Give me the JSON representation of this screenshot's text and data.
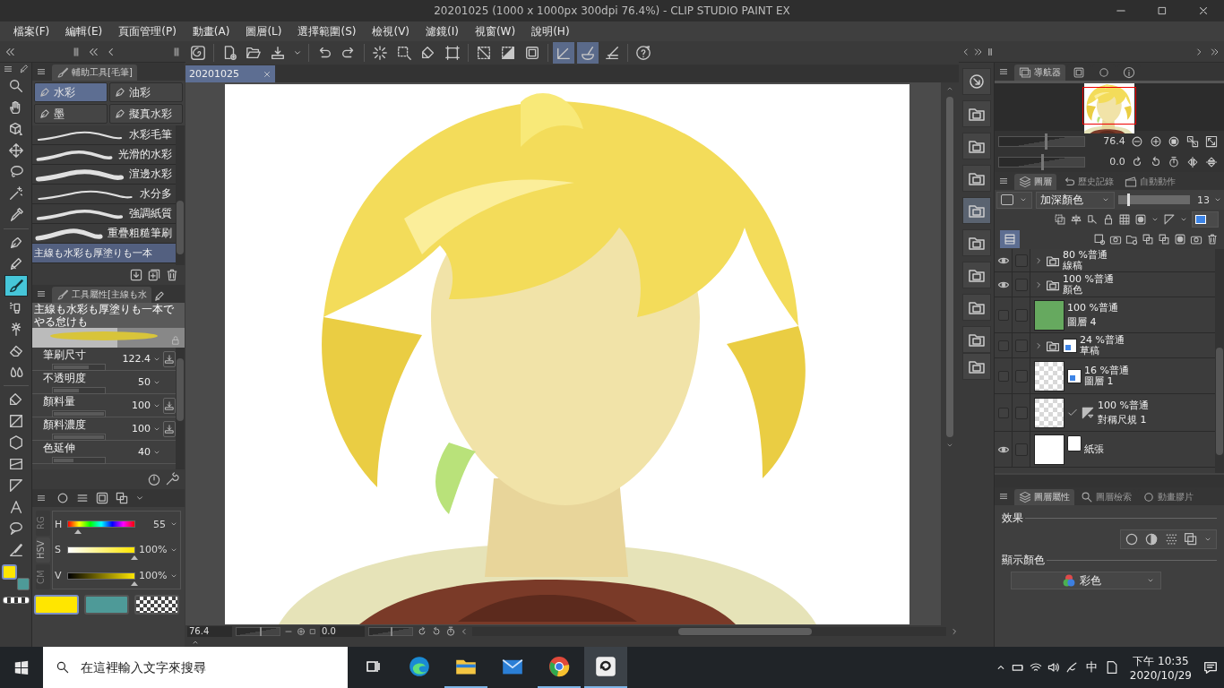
{
  "window": {
    "title": "20201025 (1000 x 1000px 300dpi 76.4%) - CLIP STUDIO PAINT EX"
  },
  "menu": [
    "檔案(F)",
    "編輯(E)",
    "頁面管理(P)",
    "動畫(A)",
    "圖層(L)",
    "選擇範圍(S)",
    "檢視(V)",
    "濾鏡(I)",
    "視窗(W)",
    "說明(H)"
  ],
  "toolbar": {
    "snap_buttons": [
      {
        "selected": true
      },
      {
        "selected": true
      },
      {
        "selected": false
      }
    ]
  },
  "tools": [
    {
      "selected": false
    },
    {
      "selected": false
    },
    {
      "selected": false
    },
    {
      "selected": false
    },
    {
      "selected": false
    },
    {
      "selected": false
    },
    {
      "selected": false
    },
    {
      "selected": false
    },
    {
      "selected": false
    },
    {
      "selected": true
    },
    {
      "selected": false
    },
    {
      "selected": false
    },
    {
      "selected": false
    },
    {
      "selected": false
    },
    {
      "selected": false
    },
    {
      "selected": false
    },
    {
      "selected": false
    },
    {
      "selected": false
    },
    {
      "selected": false
    },
    {
      "selected": false
    },
    {
      "selected": false
    },
    {
      "selected": false
    }
  ],
  "subtool_panel": {
    "tab": "輔助工具[毛筆]",
    "groups": [
      {
        "label": "水彩",
        "selected": true
      },
      {
        "label": "油彩",
        "selected": false
      },
      {
        "label": "墨",
        "selected": false
      },
      {
        "label": "擬真水彩",
        "selected": false
      }
    ],
    "brushes": [
      {
        "label": "水彩毛筆",
        "selected": false
      },
      {
        "label": "光滑的水彩",
        "selected": false
      },
      {
        "label": "渲邊水彩",
        "selected": false
      },
      {
        "label": "水分多",
        "selected": false
      },
      {
        "label": "強調紙質",
        "selected": false
      },
      {
        "label": "重疊粗糙筆刷",
        "selected": false
      },
      {
        "label": "主線も水彩も厚塗りも一本",
        "selected": true
      }
    ]
  },
  "tool_property": {
    "tab": "工具屬性[主線も水",
    "preview": "主線も水彩も厚塗りも一本でやる怠けも",
    "properties": [
      {
        "label": "筆刷尺寸",
        "value": "122.4",
        "level": 0.7,
        "pressure": true
      },
      {
        "label": "不透明度",
        "value": "50",
        "level": 0.5,
        "pressure": false
      },
      {
        "label": "顏料量",
        "value": "100",
        "level": 1,
        "pressure": true
      },
      {
        "label": "顏料濃度",
        "value": "100",
        "level": 1,
        "pressure": true
      },
      {
        "label": "色延伸",
        "value": "40",
        "level": 0.4,
        "pressure": false
      }
    ]
  },
  "color_panel": {
    "modes": [
      {
        "label": "RG",
        "selected": false
      },
      {
        "label": "HSV",
        "selected": true
      },
      {
        "label": "CM",
        "selected": false
      }
    ],
    "sliders": [
      {
        "label": "H",
        "value": "55",
        "level": 0.15
      },
      {
        "label": "S",
        "value": "100%",
        "level": 1
      },
      {
        "label": "V",
        "value": "100%",
        "level": 1
      }
    ],
    "main_color": {
      "color": "#ffe600"
    },
    "sub_color": {
      "color": "#4e9a98"
    }
  },
  "canvas": {
    "tab": "20201025",
    "zoom": {
      "value": "76.4",
      "level": 0.55
    },
    "angle": {
      "value": "0.0",
      "level": 0.5
    }
  },
  "navigator": {
    "tabs": [
      {
        "label": "導航器",
        "selected": true
      },
      {
        "selected": false
      },
      {
        "selected": false
      },
      {
        "selected": false
      }
    ],
    "zoom": {
      "value": "76.4",
      "level": 0.55
    },
    "angle": {
      "value": "0.0",
      "level": 0.5
    }
  },
  "layer_panel": {
    "tabs": [
      {
        "label": "圖層",
        "selected": true
      },
      {
        "label": "歷史記錄",
        "selected": false
      },
      {
        "label": "自動動作",
        "selected": false
      }
    ],
    "blend_mode": "加深顏色",
    "opacity": {
      "value": "13",
      "level": 0.13
    },
    "layers": [
      {
        "kind": "folder",
        "visible": true,
        "mask": false,
        "blend": "80 %普通",
        "name": "線稿"
      },
      {
        "kind": "folder",
        "visible": true,
        "mask": false,
        "blend": "100 %普通",
        "name": "顏色"
      },
      {
        "kind": "raster",
        "visible": false,
        "mask": false,
        "color": "#66a95f",
        "blend": "100 %普通",
        "name": "圖層 4"
      },
      {
        "kind": "folder",
        "visible": false,
        "mask": true,
        "blend": "24 %普通",
        "name": "草稿"
      },
      {
        "kind": "raster",
        "visible": false,
        "mask": true,
        "blend": "16 %普通",
        "name": "圖層 1"
      },
      {
        "kind": "ruler",
        "visible": false,
        "mask": false,
        "blend": "100 %普通",
        "name": "對稱尺規 1"
      },
      {
        "kind": "paper",
        "visible": true,
        "mask": false,
        "name": "紙張"
      }
    ]
  },
  "layer_property": {
    "tabs": [
      {
        "label": "圖層屬性",
        "selected": true
      },
      {
        "label": "圖層檢索",
        "selected": false
      },
      {
        "label": "動畫膠片",
        "selected": false
      }
    ],
    "effect_label": "效果",
    "display_color_label": "顯示顏色",
    "display_color": "彩色"
  },
  "taskbar": {
    "search_placeholder": "在這裡輸入文字來搜尋",
    "apps": [
      {
        "running": false,
        "selected": false
      },
      {
        "running": false,
        "selected": false
      },
      {
        "running": true,
        "selected": false
      },
      {
        "running": false,
        "selected": false
      },
      {
        "running": true,
        "selected": false
      },
      {
        "running": true,
        "selected": true
      }
    ],
    "ime": "中",
    "time": "下午 10:35",
    "date": "2020/10/29"
  }
}
